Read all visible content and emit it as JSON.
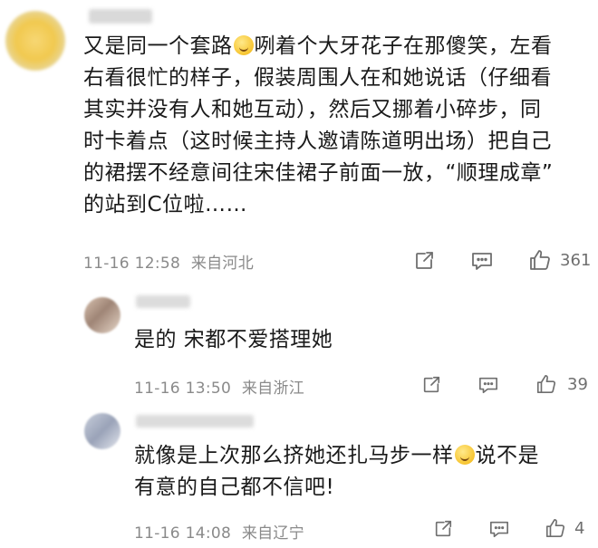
{
  "thread": {
    "main": {
      "username": "",
      "text_lines": [
        "又是同一个套路",
        "咧着个大牙花子在那傻笑，左看",
        "右看很忙的样子，假装周围人在和她说话（仔细看",
        "其实并没有人和她互动），然后又挪着小碎步，同",
        "时卡着点（这时候主持人邀请陈道明出场）把自己",
        "的裙摆不经意间往宋佳裙子前面一放，“顺理成章”",
        "的站到C位啦……"
      ],
      "time": "11-16 12:58",
      "location": "来自河北",
      "like_count": "361"
    },
    "replies": [
      {
        "username": "",
        "text": "是的 宋都不爱搭理她",
        "time": "11-16 13:50",
        "location": "来自浙江",
        "like_count": "39"
      },
      {
        "username": "",
        "text_lines": [
          "就像是上次那么挤她还扎马步一样",
          "说不是",
          "有意的自己都不信吧!"
        ],
        "time": "11-16 14:08",
        "location": "来自辽宁",
        "like_count": "4"
      }
    ]
  },
  "icons": {
    "share": "share-icon",
    "comment": "comment-icon",
    "like": "thumbs-up-icon",
    "smile": "smile-emoji-icon",
    "laugh": "laugh-tears-emoji-icon"
  }
}
